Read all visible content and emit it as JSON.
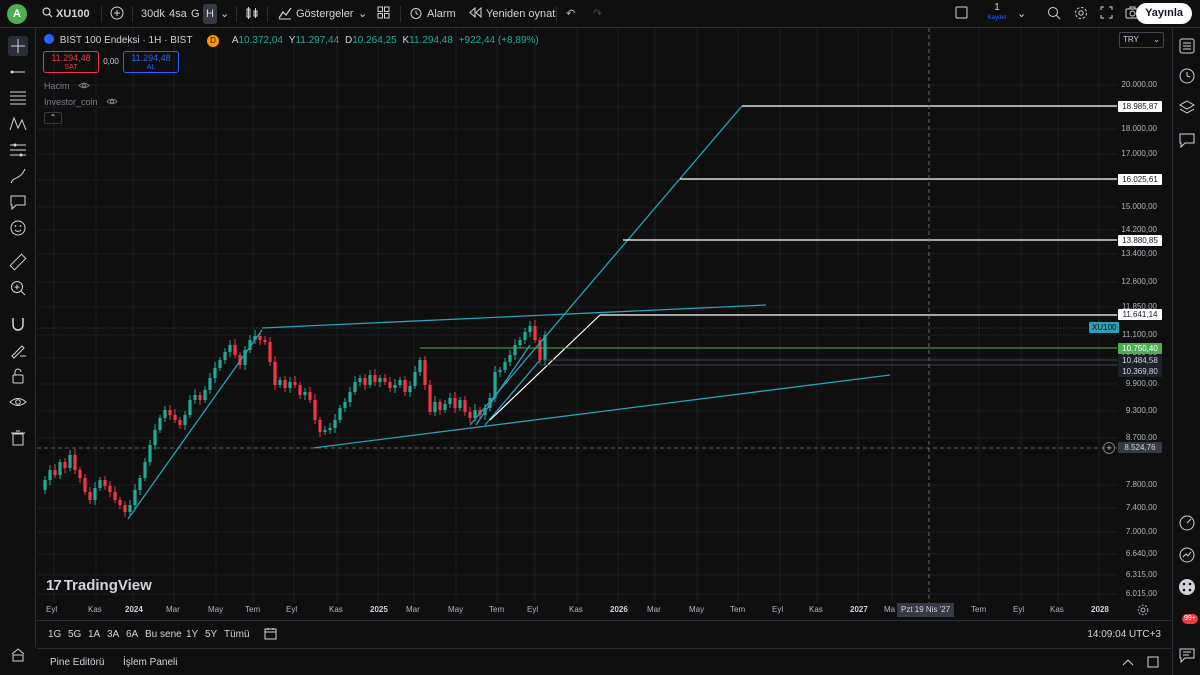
{
  "topbar": {
    "avatar_letter": "A",
    "symbol": "XU100",
    "timeframes": [
      "30dk",
      "4sa",
      "G",
      "H"
    ],
    "indicators_label": "Göstergeler",
    "alarm_label": "Alarm",
    "replay_label": "Yeniden oynat",
    "layout_count": "1",
    "layout_sub": "Kaydet",
    "publish_label": "Yayınla"
  },
  "legend": {
    "symbol_title": "BIST 100 Endeksi · 1H · BIST",
    "badge": "D",
    "open_label": "A",
    "open": "10.372,04",
    "high_label": "Y",
    "high": "11.297,44",
    "low_label": "D",
    "low": "10.264,25",
    "close_label": "K",
    "close": "11.294,48",
    "change": "+922,44 (+8,89%)",
    "sell_price": "11.294,48",
    "sell_label": "SAT",
    "spread": "0,00",
    "buy_price": "11.294,48",
    "buy_label": "AL",
    "indicator1": "Hacim",
    "indicator2": "Investor_coin"
  },
  "price_axis": {
    "currency": "TRY",
    "ticks": [
      "20.000,00",
      "19.000,00",
      "18.000,00",
      "17.000,00",
      "16.000,00",
      "15.000,00",
      "14.200,00",
      "13.400,00",
      "12.600,00",
      "11.850,00",
      "11.100,00",
      "10.500,00",
      "9.900,00",
      "9.300,00",
      "8.700,00",
      "7.800,00",
      "7.400,00",
      "7.000,00",
      "6.640,00",
      "6.315,00",
      "6.015,00"
    ],
    "tags": {
      "t1": "18.985,87",
      "t2": "16.025,61",
      "t3": "13.880,85",
      "t4": "11.641,14",
      "t5": "10.750,40",
      "t6": "10.484,58",
      "t7": "10.369,80",
      "cross": "8.524,76",
      "symbol": "XU100"
    }
  },
  "time_axis": {
    "labels": [
      "Eyl",
      "Kas",
      "2024",
      "Mar",
      "May",
      "Tem",
      "Eyl",
      "Kas",
      "2025",
      "Mar",
      "May",
      "Tem",
      "Eyl",
      "Kas",
      "2026",
      "Mar",
      "May",
      "Tem",
      "Eyl",
      "Kas",
      "2027",
      "Ma",
      "Tem",
      "Eyl",
      "Kas",
      "2028"
    ],
    "cursor_label": "Pzt 19 Nis '27"
  },
  "range_bar": {
    "buttons": [
      "1G",
      "5G",
      "1A",
      "3A",
      "6A",
      "Bu sene",
      "1Y",
      "5Y",
      "Tümü"
    ],
    "clock": "14:09:04 UTC+3"
  },
  "bottom_panel": {
    "tab1": "Pine Editörü",
    "tab2": "İşlem Paneli"
  },
  "brand": {
    "name": "TradingView"
  },
  "notifications": {
    "badge": "99+"
  },
  "colors": {
    "up": "#22ab94",
    "down": "#f23645",
    "trendline": "#2aa1b5",
    "accent": "#2962ff",
    "green_level": "#4caf50"
  }
}
